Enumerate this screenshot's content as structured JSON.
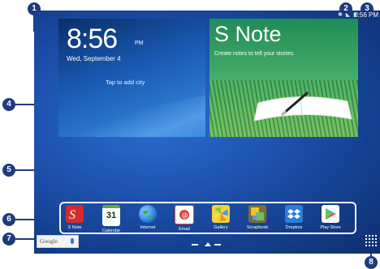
{
  "status_bar": {
    "icons": "✱ ◣ ▮",
    "time": "8:56 PM"
  },
  "weather_widget": {
    "time": "8:56",
    "ampm": "PM",
    "date": "Wed, September 4",
    "city_prompt": "Tap to add city"
  },
  "snote_widget": {
    "title": "S Note",
    "subtitle": "Create notes to tell your stories."
  },
  "apps": [
    {
      "label": "S Note"
    },
    {
      "label": "Calendar",
      "day": "31"
    },
    {
      "label": "Internet"
    },
    {
      "label": "Email"
    },
    {
      "label": "Gallery"
    },
    {
      "label": "Scrapbook"
    },
    {
      "label": "Dropbox"
    },
    {
      "label": "Play Store"
    }
  ],
  "google_bar": {
    "label": "Google"
  },
  "callouts": [
    "1",
    "2",
    "3",
    "4",
    "5",
    "6",
    "7",
    "8"
  ]
}
